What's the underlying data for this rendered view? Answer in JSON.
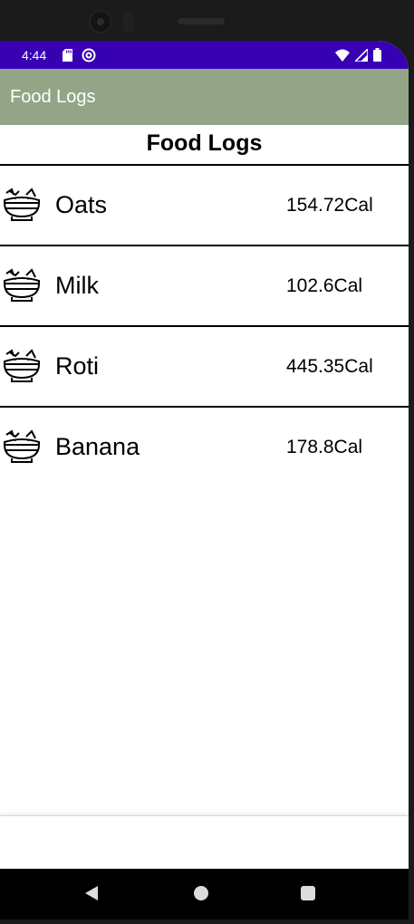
{
  "status_bar": {
    "time": "4:44",
    "left_icons": [
      "sd-card-icon",
      "at-sign-icon"
    ],
    "right_icons": [
      "wifi-icon",
      "signal-icon",
      "battery-icon"
    ],
    "color": "#3700b3"
  },
  "app_bar": {
    "title": "Food Logs",
    "color": "#93a586"
  },
  "list": {
    "header": "Food Logs",
    "items": [
      {
        "name": "Oats",
        "calories": "154.72Cal",
        "icon": "food-bowl-icon"
      },
      {
        "name": "Milk",
        "calories": "102.6Cal",
        "icon": "food-bowl-icon"
      },
      {
        "name": "Roti",
        "calories": "445.35Cal",
        "icon": "food-bowl-icon"
      },
      {
        "name": "Banana",
        "calories": "178.8Cal",
        "icon": "food-bowl-icon"
      }
    ]
  },
  "nav_bar": {
    "buttons": [
      "back-icon",
      "home-icon",
      "recents-icon"
    ]
  }
}
